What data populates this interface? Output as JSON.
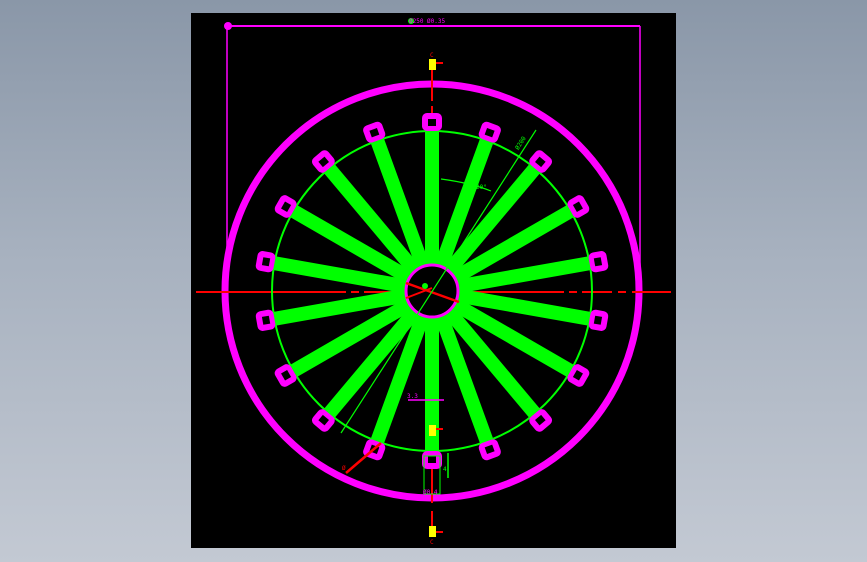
{
  "drawing": {
    "colors": {
      "background_app": "#9aa5b4",
      "viewport": "#000000",
      "outline": "#ff00ff",
      "spokes": "#00ff00",
      "centerline": "#ff0000",
      "marker": "#ffff00"
    },
    "section_labels": {
      "top": "C",
      "middle": "D",
      "bottom": "C"
    },
    "dimensions": {
      "top_overall": "Ø250 Ø0.35",
      "diag_circle": "Ø200",
      "spoke_angle": "20°",
      "hub_label": "3.3",
      "bottom_small": "4",
      "bottom_width": "Ø0.4",
      "leader": "Ø"
    },
    "spoke_count": 18,
    "pad_count": 18
  }
}
